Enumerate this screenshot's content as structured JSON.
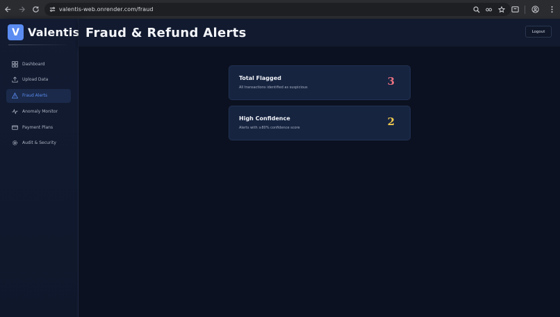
{
  "browser": {
    "url": "valentis-web.onrender.com/fraud"
  },
  "brand": {
    "logo_letter": "V",
    "name": "Valentis",
    "logo_color": "#5b8cf2"
  },
  "sidebar": {
    "items": [
      {
        "label": "Dashboard",
        "icon": "grid-icon",
        "active": false
      },
      {
        "label": "Upload Data",
        "icon": "upload-icon",
        "active": false
      },
      {
        "label": "Fraud Alerts",
        "icon": "warning-triangle-icon",
        "active": true
      },
      {
        "label": "Anomaly Monitor",
        "icon": "pulse-icon",
        "active": false
      },
      {
        "label": "Payment Plans",
        "icon": "card-icon",
        "active": false
      },
      {
        "label": "Audit & Security",
        "icon": "gear-icon",
        "active": false
      }
    ],
    "active_color": "#5b8cf2"
  },
  "header": {
    "title": "Fraud & Refund Alerts",
    "logout_label": "Logout"
  },
  "cards": [
    {
      "title": "Total Flagged",
      "subtitle": "All transactions identified as suspicious",
      "value": "3",
      "value_color": "#e8707f"
    },
    {
      "title": "High Confidence",
      "subtitle": "Alerts with ≥80% confidence score",
      "value": "2",
      "value_color": "#f0c84d"
    }
  ]
}
